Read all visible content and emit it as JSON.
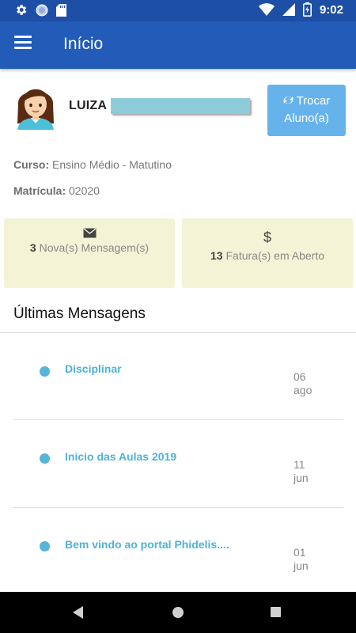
{
  "status_bar": {
    "time": "9:02"
  },
  "app_bar": {
    "title": "Início"
  },
  "profile": {
    "student_name": "LUIZA",
    "switch_button_line1": "Trocar",
    "switch_button_line2": "Aluno(a)",
    "course_label": "Curso:",
    "course_value": "Ensino Médio - Matutino",
    "enrollment_label": "Matrícula:",
    "enrollment_value": "02020"
  },
  "cards": {
    "messages": {
      "count": "3",
      "text": "Nova(s) Mensagem(s)",
      "icon": "envelope-icon"
    },
    "invoices": {
      "count": "13",
      "text": "Fatura(s) em Aberto",
      "icon": "dollar-icon"
    }
  },
  "messages_section": {
    "title": "Últimas Mensagens",
    "items": [
      {
        "title": "Disciplinar",
        "day": "06",
        "month": "ago"
      },
      {
        "title": "Inicio das Aulas 2019",
        "day": "11",
        "month": "jun"
      },
      {
        "title": "Bem vindo ao portal Phidelis....",
        "day": "01",
        "month": "jun"
      }
    ]
  },
  "colors": {
    "status_bar": "#1e4fa6",
    "app_bar": "#225bb8",
    "switch_button": "#66b3ec",
    "card_bg": "#f4f3d6",
    "accent": "#4fb2d6"
  }
}
